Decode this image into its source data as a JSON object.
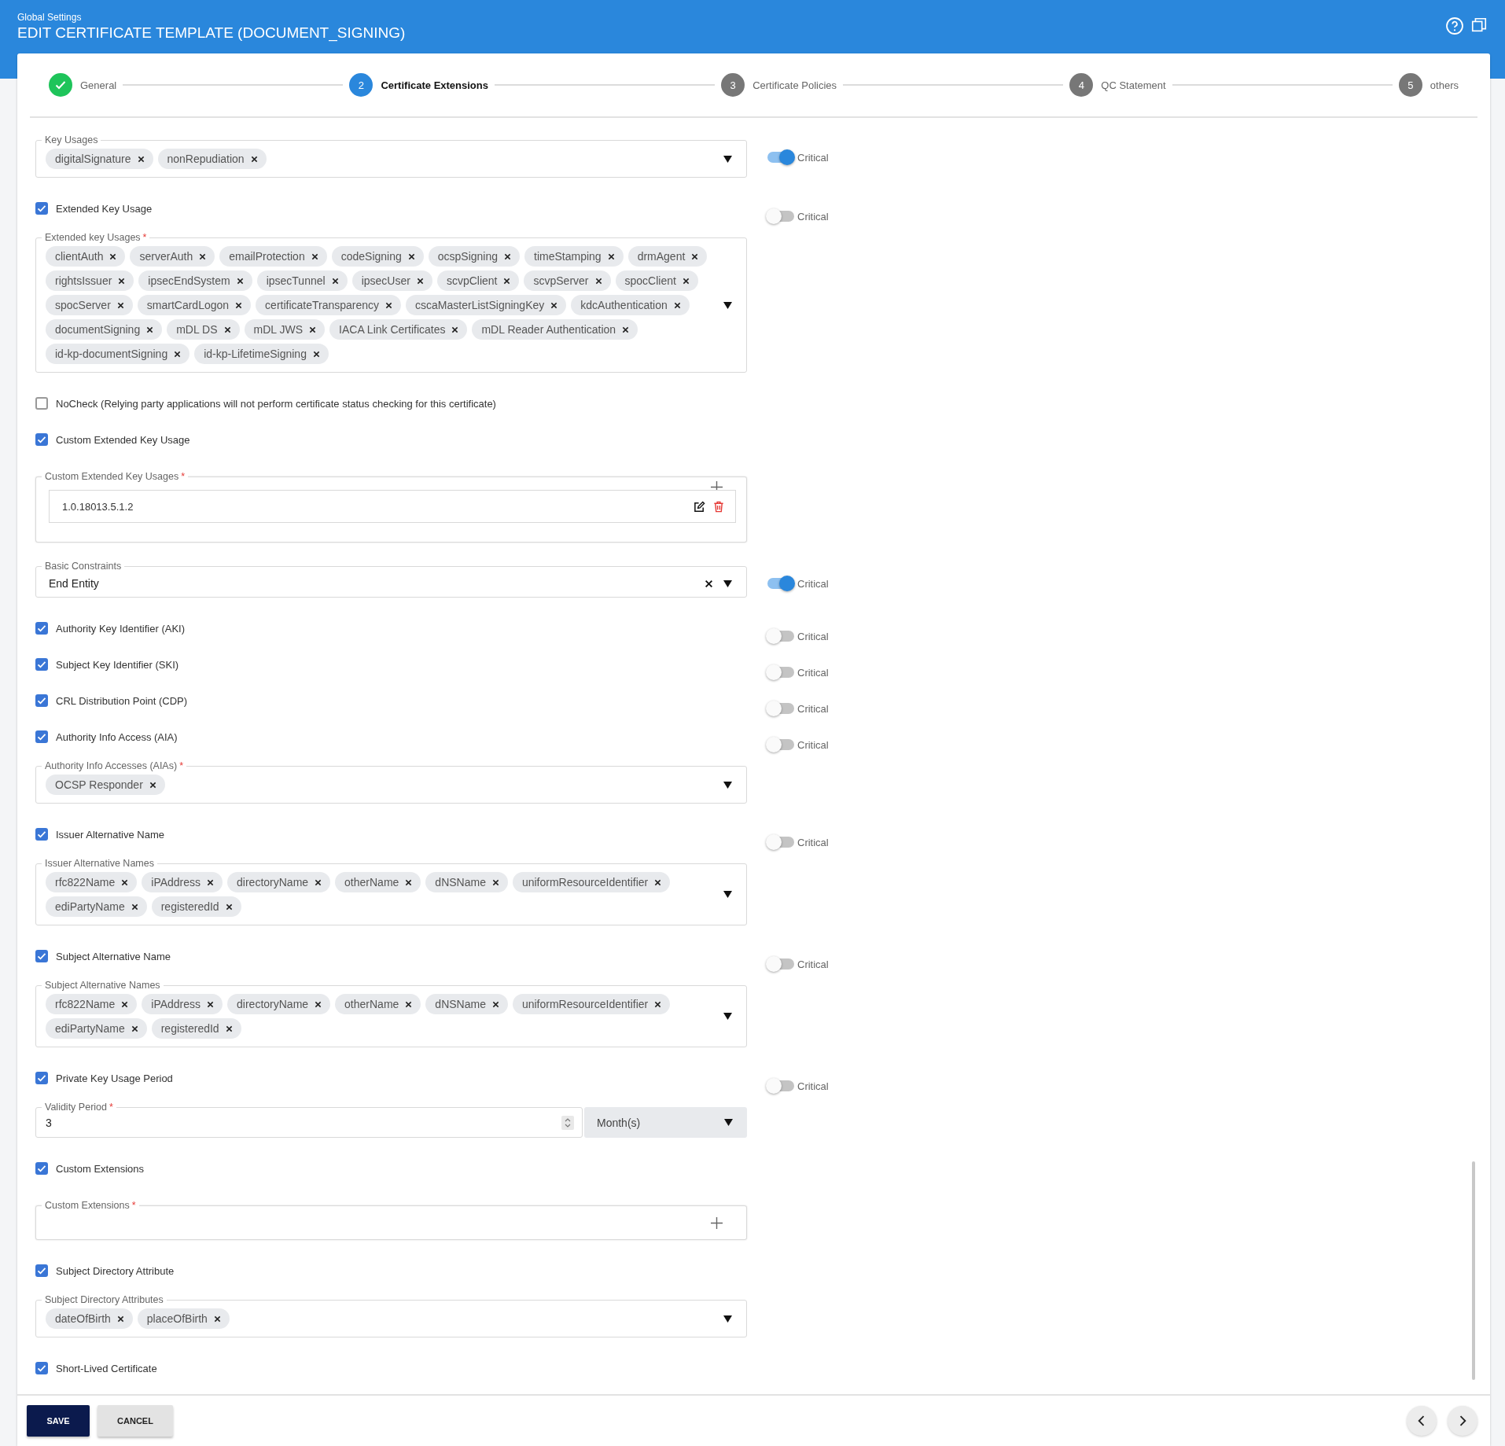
{
  "header": {
    "breadcrumb": "Global Settings",
    "title": "EDIT CERTIFICATE TEMPLATE (DOCUMENT_SIGNING)"
  },
  "steps": [
    {
      "label": "General",
      "completed": true,
      "selected": false
    },
    {
      "number": "2",
      "label": "Certificate Extensions",
      "completed": false,
      "selected": true
    },
    {
      "number": "3",
      "label": "Certificate Policies",
      "completed": false,
      "selected": false
    },
    {
      "number": "4",
      "label": "QC Statement",
      "completed": false,
      "selected": false
    },
    {
      "number": "5",
      "label": "others",
      "completed": false,
      "selected": false
    }
  ],
  "form": [
    {
      "kind": "chips",
      "label": "Key Usages",
      "chips": [
        "digitalSignature",
        "nonRepudiation"
      ],
      "critical": {
        "label": "Critical",
        "on": true
      }
    },
    {
      "kind": "check",
      "label": "Extended Key Usage",
      "checked": true,
      "critical": {
        "label": "Critical",
        "on": false
      }
    },
    {
      "kind": "chips",
      "label": "Extended key Usages",
      "required_mark": "*",
      "chips": [
        "clientAuth",
        "serverAuth",
        "emailProtection",
        "codeSigning",
        "ocspSigning",
        "timeStamping",
        "drmAgent",
        "rightsIssuer",
        "ipsecEndSystem",
        "ipsecTunnel",
        "ipsecUser",
        "scvpClient",
        "scvpServer",
        "spocClient",
        "spocServer",
        "smartCardLogon",
        "certificateTransparency",
        "cscaMasterListSigningKey",
        "kdcAuthentication",
        "documentSigning",
        "mDL DS",
        "mDL JWS",
        "IACA Link Certificates",
        "mDL Reader Authentication",
        "id-kp-documentSigning",
        "id-kp-LifetimeSigning"
      ]
    },
    {
      "kind": "check",
      "label": "NoCheck (Relying party applications will not perform certificate status checking for this certificate)",
      "checked": false
    },
    {
      "kind": "check",
      "label": "Custom Extended Key Usage",
      "checked": true
    },
    {
      "kind": "list",
      "label": "Custom Extended Key Usages",
      "required_mark": "*",
      "items": [
        "1.0.18013.5.1.2"
      ]
    },
    {
      "kind": "select",
      "label": "Basic Constraints",
      "value": "End Entity",
      "critical": {
        "label": "Critical",
        "on": true
      }
    },
    {
      "kind": "check",
      "label": "Authority Key Identifier (AKI)",
      "checked": true,
      "critical": {
        "label": "Critical",
        "on": false
      }
    },
    {
      "kind": "check",
      "label": "Subject Key Identifier (SKI)",
      "checked": true,
      "critical": {
        "label": "Critical",
        "on": false
      }
    },
    {
      "kind": "check",
      "label": "CRL Distribution Point (CDP)",
      "checked": true,
      "critical": {
        "label": "Critical",
        "on": false
      }
    },
    {
      "kind": "check",
      "label": "Authority Info Access (AIA)",
      "checked": true,
      "critical": {
        "label": "Critical",
        "on": false
      }
    },
    {
      "kind": "chips",
      "label": "Authority Info Accesses (AIAs)",
      "required_mark": "*",
      "chips": [
        "OCSP Responder"
      ]
    },
    {
      "kind": "check",
      "label": "Issuer Alternative Name",
      "checked": true,
      "critical": {
        "label": "Critical",
        "on": false
      }
    },
    {
      "kind": "chips",
      "label": "Issuer Alternative Names",
      "chips": [
        "rfc822Name",
        "iPAddress",
        "directoryName",
        "otherName",
        "dNSName",
        "uniformResourceIdentifier",
        "ediPartyName",
        "registeredId"
      ]
    },
    {
      "kind": "check",
      "label": "Subject Alternative Name",
      "checked": true,
      "critical": {
        "label": "Critical",
        "on": false
      }
    },
    {
      "kind": "chips",
      "label": "Subject Alternative Names",
      "chips": [
        "rfc822Name",
        "iPAddress",
        "directoryName",
        "otherName",
        "dNSName",
        "uniformResourceIdentifier",
        "ediPartyName",
        "registeredId"
      ]
    },
    {
      "kind": "check",
      "label": "Private Key Usage Period",
      "checked": true,
      "critical": {
        "label": "Critical",
        "on": false
      }
    },
    {
      "kind": "period",
      "label": "Validity Period",
      "required_mark": "*",
      "value": "3",
      "unit": "Month(s)"
    },
    {
      "kind": "check",
      "label": "Custom Extensions",
      "checked": true
    },
    {
      "kind": "list",
      "label": "Custom Extensions",
      "required_mark": "*"
    },
    {
      "kind": "check",
      "label": "Subject Directory Attribute",
      "checked": true
    },
    {
      "kind": "chips",
      "label": "Subject Directory Attributes",
      "chips": [
        "dateOfBirth",
        "placeOfBirth"
      ]
    },
    {
      "kind": "check",
      "label": "Short-Lived Certificate",
      "checked": true
    }
  ],
  "footer": {
    "buttons": [
      {
        "label": "SAVE",
        "kind": "primary"
      },
      {
        "label": "CANCEL",
        "kind": "secondary"
      }
    ]
  }
}
